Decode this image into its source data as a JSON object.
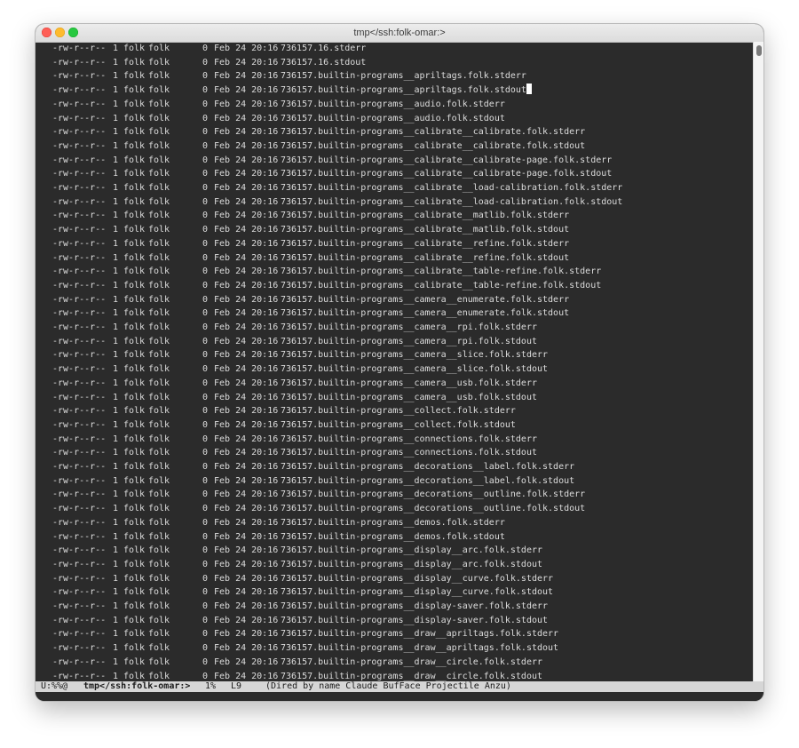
{
  "window": {
    "title": "tmp</ssh:folk-omar:>"
  },
  "listing": {
    "common": {
      "perm": "-rw-r--r--",
      "links": "1",
      "owner": "folk",
      "group": "folk",
      "size": "0",
      "date": "Feb 24 20:16"
    },
    "files": [
      "736157.16.stderr",
      "736157.16.stdout",
      "736157.builtin-programs__apriltags.folk.stderr",
      "736157.builtin-programs__apriltags.folk.stdout",
      "736157.builtin-programs__audio.folk.stderr",
      "736157.builtin-programs__audio.folk.stdout",
      "736157.builtin-programs__calibrate__calibrate.folk.stderr",
      "736157.builtin-programs__calibrate__calibrate.folk.stdout",
      "736157.builtin-programs__calibrate__calibrate-page.folk.stderr",
      "736157.builtin-programs__calibrate__calibrate-page.folk.stdout",
      "736157.builtin-programs__calibrate__load-calibration.folk.stderr",
      "736157.builtin-programs__calibrate__load-calibration.folk.stdout",
      "736157.builtin-programs__calibrate__matlib.folk.stderr",
      "736157.builtin-programs__calibrate__matlib.folk.stdout",
      "736157.builtin-programs__calibrate__refine.folk.stderr",
      "736157.builtin-programs__calibrate__refine.folk.stdout",
      "736157.builtin-programs__calibrate__table-refine.folk.stderr",
      "736157.builtin-programs__calibrate__table-refine.folk.stdout",
      "736157.builtin-programs__camera__enumerate.folk.stderr",
      "736157.builtin-programs__camera__enumerate.folk.stdout",
      "736157.builtin-programs__camera__rpi.folk.stderr",
      "736157.builtin-programs__camera__rpi.folk.stdout",
      "736157.builtin-programs__camera__slice.folk.stderr",
      "736157.builtin-programs__camera__slice.folk.stdout",
      "736157.builtin-programs__camera__usb.folk.stderr",
      "736157.builtin-programs__camera__usb.folk.stdout",
      "736157.builtin-programs__collect.folk.stderr",
      "736157.builtin-programs__collect.folk.stdout",
      "736157.builtin-programs__connections.folk.stderr",
      "736157.builtin-programs__connections.folk.stdout",
      "736157.builtin-programs__decorations__label.folk.stderr",
      "736157.builtin-programs__decorations__label.folk.stdout",
      "736157.builtin-programs__decorations__outline.folk.stderr",
      "736157.builtin-programs__decorations__outline.folk.stdout",
      "736157.builtin-programs__demos.folk.stderr",
      "736157.builtin-programs__demos.folk.stdout",
      "736157.builtin-programs__display__arc.folk.stderr",
      "736157.builtin-programs__display__arc.folk.stdout",
      "736157.builtin-programs__display__curve.folk.stderr",
      "736157.builtin-programs__display__curve.folk.stdout",
      "736157.builtin-programs__display-saver.folk.stderr",
      "736157.builtin-programs__display-saver.folk.stdout",
      "736157.builtin-programs__draw__apriltags.folk.stderr",
      "736157.builtin-programs__draw__apriltags.folk.stdout",
      "736157.builtin-programs__draw__circle.folk.stderr",
      "736157.builtin-programs__draw__circle.folk.stdout"
    ],
    "cursor_line": 4
  },
  "modeline": {
    "state": "U:%%@",
    "buffer": "tmp</ssh:folk-omar:>",
    "percent": "1%",
    "line": "L9",
    "modes": "(Dired by name Claude BufFace Projectile Anzu)"
  },
  "icons": {
    "close": "close-icon",
    "minimize": "minimize-icon",
    "maximize": "maximize-icon"
  },
  "colors": {
    "background": "#2b2b2b",
    "foreground": "#dcdcdc",
    "modeline": "#d6d6d6",
    "close": "#fe5f57",
    "minimize": "#febb2e",
    "maximize": "#28c840"
  }
}
